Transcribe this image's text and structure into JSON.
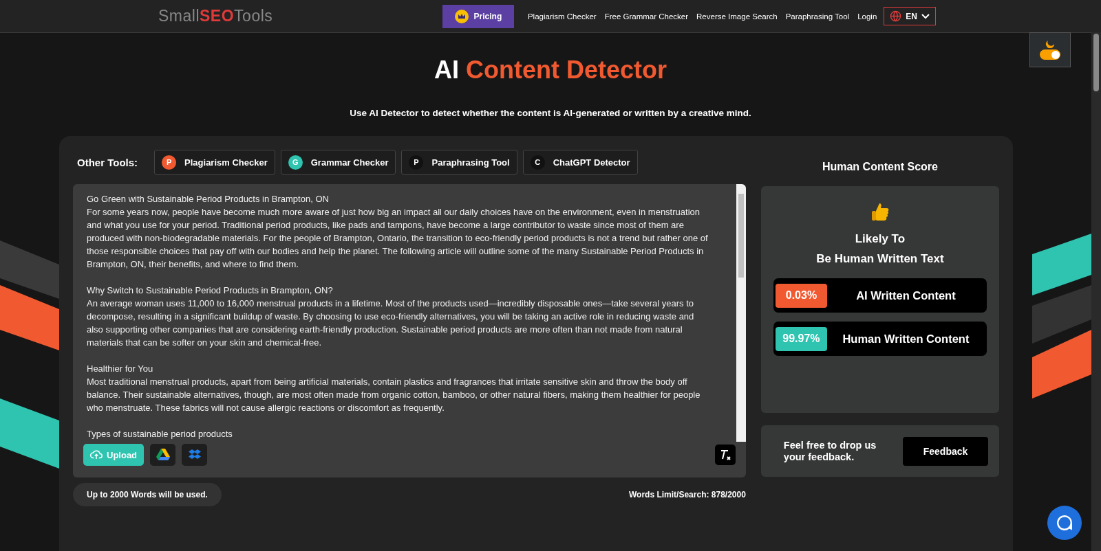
{
  "header": {
    "logo": {
      "part_1": "Small",
      "part_2": "SEO",
      "part_3": "Tools"
    },
    "pricing": "Pricing",
    "nav": [
      "Plagiarism Checker",
      "Free Grammar Checker",
      "Reverse Image Search",
      "Paraphrasing Tool",
      "Login"
    ],
    "language": "EN"
  },
  "theme_toggle": {
    "on": true
  },
  "hero": {
    "title_1": "AI",
    "title_2": "Content Detector",
    "subtitle": "Use AI Detector to detect whether the content is AI-generated or written by a creative mind."
  },
  "other_tools": {
    "label": "Other Tools:",
    "items": [
      {
        "letter": "P",
        "label": "Plagiarism Checker",
        "color": "#f15a31"
      },
      {
        "letter": "G",
        "label": "Grammar Checker",
        "color": "#2ec4b0"
      },
      {
        "letter": "P",
        "label": "Paraphrasing Tool",
        "color": "#111111"
      },
      {
        "letter": "C",
        "label": "ChatGPT Detector",
        "color": "#111111"
      }
    ]
  },
  "editor": {
    "paragraphs": [
      {
        "heading": "Go Green with Sustainable Period Products in Brampton, ON",
        "body": "For some years now, people have become much more aware of just how big an impact all our daily choices have on the environment, even in menstruation and what you use for your period. Traditional period products, like pads and tampons, have become a large contributor to waste since most of them are produced with non-biodegradable materials. For the people of Brampton, Ontario, the transition to eco-friendly period products is not a trend but rather one of those responsible choices that pay off with our bodies and help the planet. The following article will outline some of the many Sustainable Period Products in Brampton, ON, their benefits, and where to find them."
      },
      {
        "heading": "Why Switch to Sustainable Period Products in Brampton, ON?",
        "body": "An average woman uses 11,000 to 16,000 menstrual products in a lifetime. Most of the products used—incredibly disposable ones—take several years to decompose, resulting in a significant buildup of waste. By choosing to use eco-friendly alternatives, you will be taking an active role in reducing waste and also supporting other companies that are considering earth-friendly production. Sustainable period products are more often than not made from natural materials that can be softer on your skin and chemical-free."
      },
      {
        "heading": "Healthier for You",
        "body": "Most traditional menstrual products, apart from being artificial materials, contain plastics and fragrances that irritate sensitive skin and throw the body off balance. Their sustainable alternatives, though, are most often made from organic cotton, bamboo, or other natural fibers, making them healthier for people who menstruate. These fabrics will not cause allergic reactions or discomfort as frequently."
      },
      {
        "heading": "Types of sustainable period products"
      }
    ],
    "upload": "Upload",
    "note": "Up to 2000 Words will be used.",
    "word_count": "Words Limit/Search: 878/2000"
  },
  "result": {
    "title": "Human Content Score",
    "verdict_1": "Likely To",
    "verdict_2": "Be Human Written Text",
    "scores": [
      {
        "value": "0.03%",
        "label": "AI Written Content",
        "color": "#f15a31"
      },
      {
        "value": "99.97%",
        "label": "Human Written Content",
        "color": "#2ec4b0"
      }
    ]
  },
  "feedback": {
    "text": "Feel free to drop us your feedback.",
    "button": "Feedback"
  }
}
